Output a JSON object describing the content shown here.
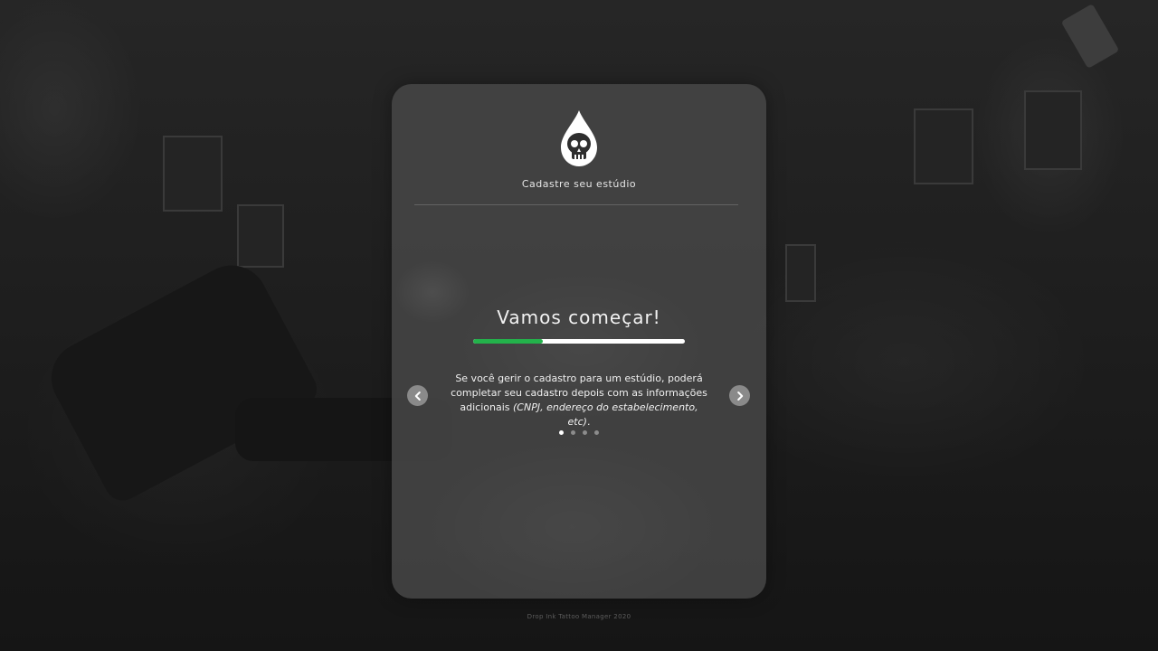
{
  "app": {
    "subtitle": "Cadastre seu estúdio",
    "logo_icon": "skull-drop-icon",
    "accent_color": "#23b24b"
  },
  "step": {
    "headline": "Vamos começar!",
    "progress_percent": 33,
    "description_main": "Se você gerir o cadastro para um estúdio, poderá completar seu cadastro depois com as informações adicionais ",
    "description_italic": "(CNPJ, endereço do estabelecimento, etc)",
    "description_end": "."
  },
  "carousel": {
    "prev_icon": "chevron-left-icon",
    "next_icon": "chevron-right-icon",
    "total_slides": 4,
    "active_slide": 1
  },
  "footer": {
    "text": "Drop Ink Tattoo Manager 2020"
  }
}
